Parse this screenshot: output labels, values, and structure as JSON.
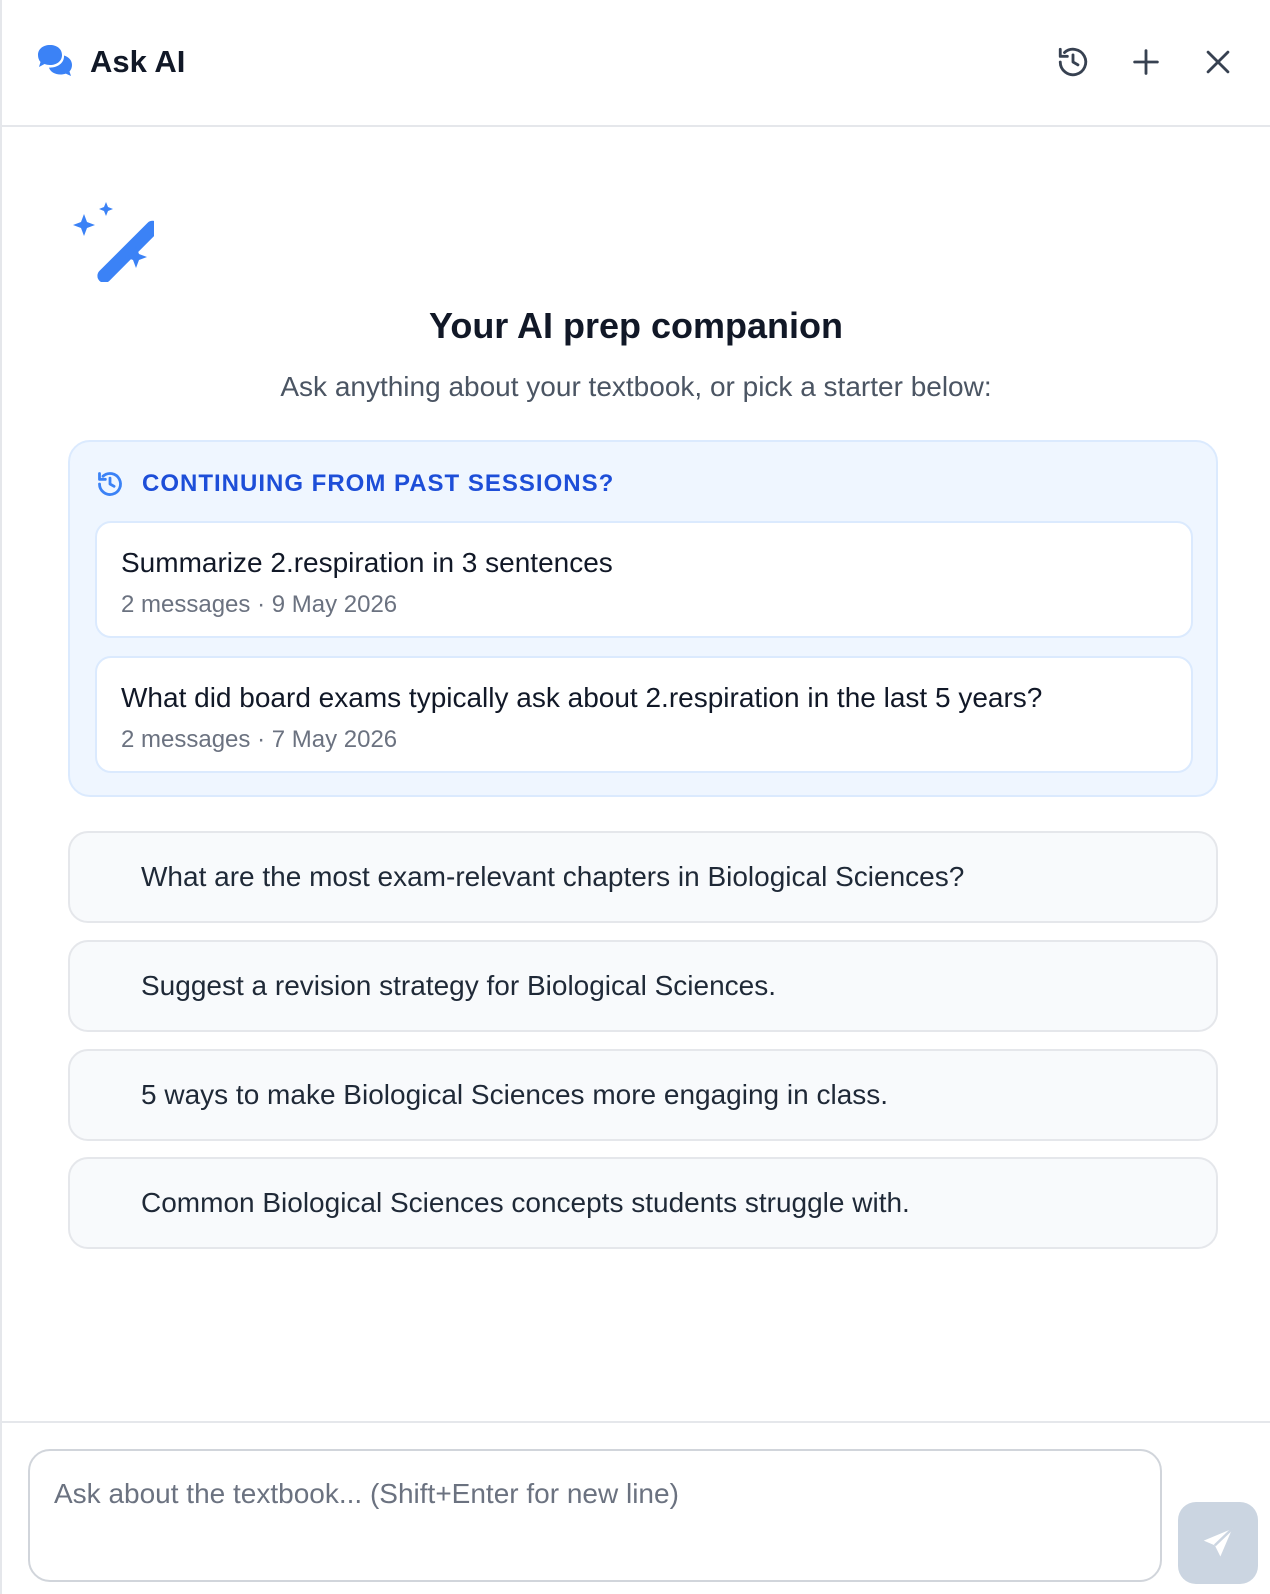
{
  "header": {
    "title": "Ask AI",
    "icons": {
      "brand": "chat-bubbles-icon",
      "history": "history-icon",
      "new": "plus-icon",
      "close": "close-icon"
    }
  },
  "hero": {
    "icon": "magic-wand-sparkles-icon",
    "title": "Your AI prep companion",
    "subtitle": "Ask anything about your textbook, or pick a starter below:"
  },
  "past_sessions": {
    "heading": "CONTINUING FROM PAST SESSIONS?",
    "items": [
      {
        "title": "Summarize 2.respiration in 3 sentences",
        "meta": "2 messages · 9 May 2026"
      },
      {
        "title": "What did board exams typically ask about 2.respiration in the last 5 years?",
        "meta": "2 messages · 7 May 2026"
      }
    ]
  },
  "starters": [
    "What are the most exam-relevant chapters in Biological Sciences?",
    "Suggest a revision strategy for Biological Sciences.",
    "5 ways to make Biological Sciences more engaging in class.",
    "Common Biological Sciences concepts students struggle with."
  ],
  "composer": {
    "placeholder": "Ask about the textbook... (Shift+Enter for new line)",
    "value": ""
  },
  "colors": {
    "accent": "#3b82f6",
    "accent_dark": "#1d4ed8",
    "past_bg": "#eff6ff",
    "send_disabled": "#cbd5e1"
  }
}
